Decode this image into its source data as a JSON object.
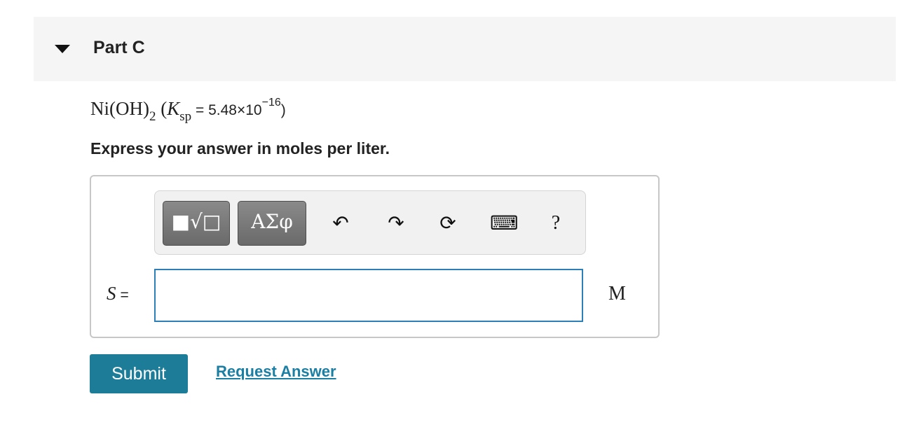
{
  "part": {
    "title": "Part C",
    "caret_icon": "caret-down-icon"
  },
  "question": {
    "compound": "Ni(OH)",
    "compound_subscript": "2",
    "open_paren": "(",
    "k": "K",
    "k_subscript": "sp",
    "equals_value": " = 5.48×10",
    "exponent": "−16",
    "close_paren": ")"
  },
  "instruction": "Express your answer in moles per liter.",
  "toolbar": {
    "templates_label": "■√□",
    "symbols_label": "ΑΣφ",
    "undo_icon": "↶",
    "redo_icon": "↷",
    "reset_icon": "⟳",
    "keyboard_icon": "⌨",
    "help_label": "?"
  },
  "answer": {
    "variable": "S",
    "equals": "=",
    "value": "",
    "unit": "M"
  },
  "actions": {
    "submit_label": "Submit",
    "request_label": "Request Answer"
  },
  "colors": {
    "header_bg": "#f5f5f5",
    "submit_bg": "#1d7c97",
    "link": "#1b7ea3",
    "input_border": "#2c7fb8"
  }
}
